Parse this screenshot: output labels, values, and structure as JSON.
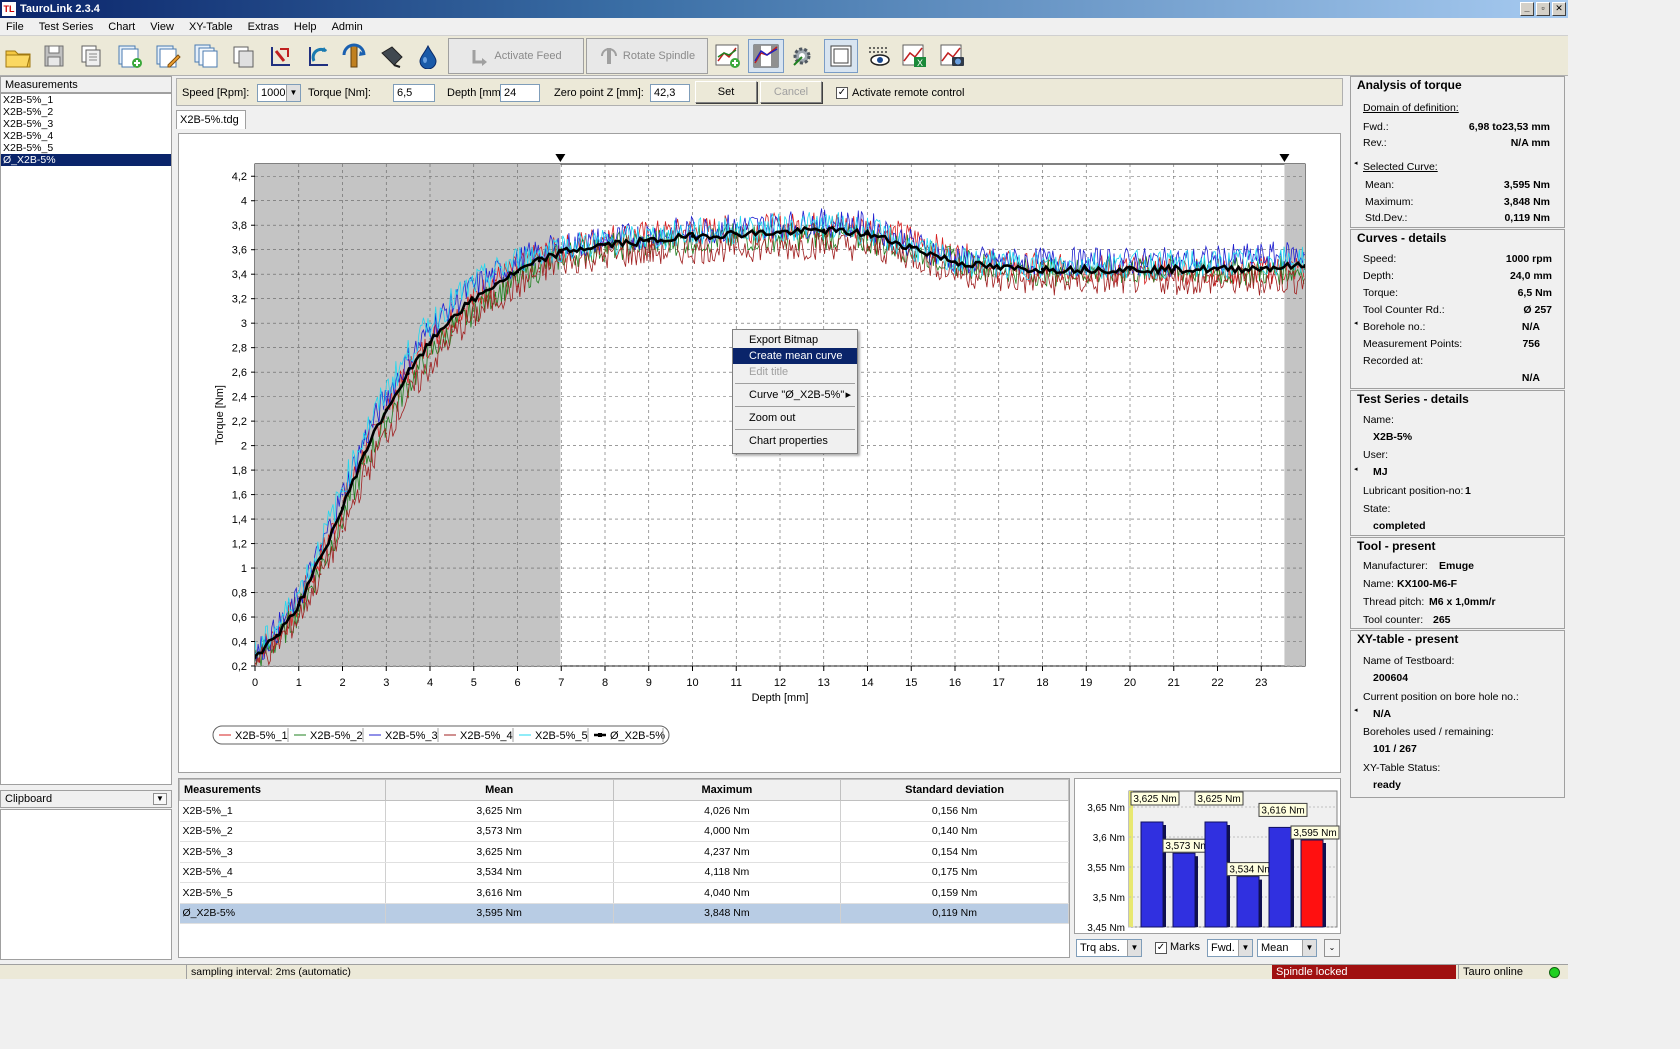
{
  "window": {
    "title": "TauroLink 2.3.4",
    "logo": "TL",
    "min": "_",
    "max": "▫",
    "close": "✕"
  },
  "menu": [
    "File",
    "Test Series",
    "Chart",
    "View",
    "XY-Table",
    "Extras",
    "Help",
    "Admin"
  ],
  "toolbar": {
    "activate_feed": "Activate Feed",
    "rotate_spindle": "Rotate Spindle"
  },
  "measurements_panel": {
    "title": "Measurements",
    "items": [
      "X2B-5%_1",
      "X2B-5%_2",
      "X2B-5%_3",
      "X2B-5%_4",
      "X2B-5%_5",
      "Ø_X2B-5%"
    ],
    "selected_index": 5
  },
  "clipboard_panel": {
    "title": "Clipboard"
  },
  "controls": {
    "speed_label": "Speed [Rpm]:",
    "speed_value": "1000",
    "torque_label": "Torque [Nm]:",
    "torque_value": "6,5",
    "depth_label": "Depth [mm]",
    "depth_value": "24",
    "zero_label": "Zero point Z [mm]:",
    "zero_value": "42,3",
    "set_label": "Set",
    "cancel_label": "Cancel",
    "remote_label": "Activate remote control",
    "remote_checked": true
  },
  "file_tab": "X2B-5%.tdg",
  "chart_data": {
    "type": "line",
    "xlabel": "Depth [mm]",
    "ylabel": "Torque [Nm]",
    "xlim": [
      0,
      24
    ],
    "ylim": [
      0.2,
      4.3
    ],
    "xticks": [
      "0",
      "1",
      "2",
      "3",
      "4",
      "5",
      "6",
      "7",
      "8",
      "9",
      "10",
      "11",
      "12",
      "13",
      "14",
      "15",
      "16",
      "17",
      "18",
      "19",
      "20",
      "21",
      "22",
      "23"
    ],
    "yticks": [
      "0,2",
      "0,4",
      "0,6",
      "0,8",
      "1",
      "1,2",
      "1,4",
      "1,6",
      "1,8",
      "2",
      "2,2",
      "2,4",
      "2,6",
      "2,8",
      "3",
      "3,2",
      "3,4",
      "3,6",
      "3,8",
      "4",
      "4,2"
    ],
    "grid": true,
    "shaded_regions": [
      [
        0,
        6.98
      ],
      [
        23.53,
        24
      ]
    ],
    "markers": [
      6.98,
      23.53
    ],
    "legend_position": "bottom-left",
    "series": [
      {
        "name": "X2B-5%_1",
        "color": "#d62020",
        "x": [
          0,
          0.5,
          1,
          1.5,
          2,
          2.5,
          3,
          3.5,
          4,
          4.5,
          5,
          5.5,
          6,
          6.5,
          7,
          8,
          9,
          10,
          11,
          12,
          13,
          14,
          15,
          16,
          17,
          18,
          19,
          20,
          21,
          22,
          23,
          24
        ],
        "y": [
          0.3,
          0.45,
          0.7,
          1.1,
          1.5,
          1.95,
          2.3,
          2.6,
          2.85,
          3.05,
          3.2,
          3.35,
          3.45,
          3.55,
          3.6,
          3.7,
          3.72,
          3.75,
          3.77,
          3.78,
          3.8,
          3.78,
          3.7,
          3.55,
          3.48,
          3.45,
          3.44,
          3.44,
          3.44,
          3.42,
          3.43,
          3.45
        ]
      },
      {
        "name": "X2B-5%_2",
        "color": "#208020",
        "x": [
          0,
          0.5,
          1,
          1.5,
          2,
          2.5,
          3,
          3.5,
          4,
          4.5,
          5,
          5.5,
          6,
          6.5,
          7,
          8,
          9,
          10,
          11,
          12,
          13,
          14,
          15,
          16,
          17,
          18,
          19,
          20,
          21,
          22,
          23,
          24
        ],
        "y": [
          0.25,
          0.4,
          0.65,
          1.0,
          1.4,
          1.85,
          2.2,
          2.5,
          2.75,
          2.95,
          3.1,
          3.25,
          3.35,
          3.45,
          3.55,
          3.62,
          3.65,
          3.68,
          3.7,
          3.7,
          3.72,
          3.68,
          3.6,
          3.5,
          3.45,
          3.42,
          3.42,
          3.43,
          3.43,
          3.42,
          3.42,
          3.44
        ]
      },
      {
        "name": "X2B-5%_3",
        "color": "#2020d0",
        "x": [
          0,
          0.5,
          1,
          1.5,
          2,
          2.5,
          3,
          3.5,
          4,
          4.5,
          5,
          5.5,
          6,
          6.5,
          7,
          8,
          9,
          10,
          11,
          12,
          13,
          14,
          15,
          16,
          17,
          18,
          19,
          20,
          21,
          22,
          23,
          24
        ],
        "y": [
          0.28,
          0.5,
          0.75,
          1.15,
          1.6,
          2.05,
          2.4,
          2.7,
          2.95,
          3.15,
          3.3,
          3.4,
          3.5,
          3.58,
          3.62,
          3.68,
          3.72,
          3.76,
          3.78,
          3.8,
          3.82,
          3.8,
          3.65,
          3.52,
          3.5,
          3.5,
          3.5,
          3.5,
          3.5,
          3.52,
          3.54,
          3.56
        ]
      },
      {
        "name": "X2B-5%_4",
        "color": "#a02020",
        "x": [
          0,
          0.5,
          1,
          1.5,
          2,
          2.5,
          3,
          3.5,
          4,
          4.5,
          5,
          5.5,
          6,
          6.5,
          7,
          8,
          9,
          10,
          11,
          12,
          13,
          14,
          15,
          16,
          17,
          18,
          19,
          20,
          21,
          22,
          23,
          24
        ],
        "y": [
          0.22,
          0.38,
          0.6,
          0.95,
          1.3,
          1.75,
          2.1,
          2.4,
          2.65,
          2.9,
          3.05,
          3.2,
          3.3,
          3.42,
          3.5,
          3.55,
          3.58,
          3.6,
          3.62,
          3.62,
          3.64,
          3.62,
          3.55,
          3.42,
          3.36,
          3.34,
          3.34,
          3.35,
          3.35,
          3.34,
          3.34,
          3.36
        ]
      },
      {
        "name": "X2B-5%_5",
        "color": "#20d8f0",
        "x": [
          0,
          0.5,
          1,
          1.5,
          2,
          2.5,
          3,
          3.5,
          4,
          4.5,
          5,
          5.5,
          6,
          6.5,
          7,
          8,
          9,
          10,
          11,
          12,
          13,
          14,
          15,
          16,
          17,
          18,
          19,
          20,
          21,
          22,
          23,
          24
        ],
        "y": [
          0.3,
          0.52,
          0.8,
          1.2,
          1.65,
          2.1,
          2.45,
          2.75,
          3.0,
          3.18,
          3.32,
          3.42,
          3.52,
          3.58,
          3.62,
          3.66,
          3.7,
          3.74,
          3.76,
          3.78,
          3.8,
          3.76,
          3.62,
          3.5,
          3.48,
          3.47,
          3.48,
          3.48,
          3.48,
          3.48,
          3.5,
          3.52
        ]
      },
      {
        "name": "Ø_X2B-5%",
        "color": "#000000",
        "x": [
          0,
          0.5,
          1,
          1.5,
          2,
          2.5,
          3,
          3.5,
          4,
          4.5,
          5,
          5.5,
          6,
          6.5,
          7,
          8,
          9,
          10,
          11,
          12,
          13,
          14,
          15,
          16,
          17,
          18,
          19,
          20,
          21,
          22,
          23,
          24
        ],
        "y": [
          0.27,
          0.45,
          0.7,
          1.08,
          1.49,
          1.94,
          2.29,
          2.59,
          2.84,
          3.05,
          3.19,
          3.32,
          3.42,
          3.51,
          3.58,
          3.64,
          3.67,
          3.71,
          3.73,
          3.74,
          3.76,
          3.73,
          3.62,
          3.5,
          3.45,
          3.44,
          3.44,
          3.44,
          3.44,
          3.44,
          3.45,
          3.47
        ]
      }
    ]
  },
  "context_menu": {
    "items": [
      "Export Bitmap",
      "Create mean curve",
      "Edit title",
      "Curve \"Ø_X2B-5%\"",
      "Zoom out",
      "Chart properties"
    ],
    "submenu_arrow": "▸"
  },
  "results_table": {
    "headers": [
      "Measurements",
      "Mean",
      "Maximum",
      "Standard deviation"
    ],
    "rows": [
      [
        "X2B-5%_1",
        "3,625 Nm",
        "4,026 Nm",
        "0,156 Nm"
      ],
      [
        "X2B-5%_2",
        "3,573 Nm",
        "4,000 Nm",
        "0,140 Nm"
      ],
      [
        "X2B-5%_3",
        "3,625 Nm",
        "4,237 Nm",
        "0,154 Nm"
      ],
      [
        "X2B-5%_4",
        "3,534 Nm",
        "4,118 Nm",
        "0,175 Nm"
      ],
      [
        "X2B-5%_5",
        "3,616 Nm",
        "4,040 Nm",
        "0,159 Nm"
      ],
      [
        "Ø_X2B-5%",
        "3,595 Nm",
        "3,848 Nm",
        "0,119 Nm"
      ]
    ],
    "selected_row": 5
  },
  "bar_chart": {
    "yticks": [
      "3,65 Nm",
      "3,6 Nm",
      "3,55 Nm",
      "3,5 Nm",
      "3,45 Nm"
    ],
    "ylim": [
      3.45,
      3.66
    ],
    "values": [
      3.625,
      3.573,
      3.625,
      3.534,
      3.616,
      3.595
    ],
    "labels": [
      "3,625 Nm",
      "3,573 Nm",
      "3,625 Nm",
      "3,534 Nm",
      "3,616 Nm",
      "3,595 Nm"
    ],
    "colors": [
      "#3030e0",
      "#3030e0",
      "#3030e0",
      "#3030e0",
      "#3030e0",
      "#ff1010"
    ]
  },
  "bar_controls": {
    "mode": "Trq abs.",
    "marks_label": "Marks",
    "marks_checked": true,
    "direction": "Fwd.",
    "stat": "Mean"
  },
  "right_panel": {
    "analysis": {
      "title": "Analysis of torque",
      "domain_label": "Domain of definition:",
      "fwd_label": "Fwd.:",
      "fwd_value": "6,98 to23,53  mm",
      "rev_label": "Rev.:",
      "rev_value": "N/A   mm",
      "selected_label": "Selected Curve:",
      "mean_label": "Mean:",
      "mean_value": "3,595  Nm",
      "max_label": "Maximum:",
      "max_value": "3,848  Nm",
      "std_label": "Std.Dev.:",
      "std_value": "0,119  Nm"
    },
    "curves": {
      "title": "Curves - details",
      "speed_label": "Speed:",
      "speed_value": "1000  rpm",
      "depth_label": "Depth:",
      "depth_value": "24,0  mm",
      "torque_label": "Torque:",
      "torque_value": "6,5  Nm",
      "counter_label": "Tool Counter Rd.:",
      "counter_value": "Ø 257",
      "bore_label": "Borehole no.:",
      "bore_value": "N/A",
      "points_label": "Measurement Points:",
      "points_value": "756",
      "recorded_label": "Recorded at:",
      "recorded_value": "N/A"
    },
    "series": {
      "title": "Test Series - details",
      "name_label": "Name:",
      "name_value": "X2B-5%",
      "user_label": "User:",
      "user_value": "MJ",
      "lub_label": "Lubricant position-no:",
      "lub_value": "1",
      "state_label": "State:",
      "state_value": "completed"
    },
    "tool": {
      "title": "Tool - present",
      "man_label": "Manufacturer:",
      "man_value": "Emuge",
      "name_label": "Name:",
      "name_value": "KX100-M6-F",
      "pitch_label": "Thread pitch:",
      "pitch_value": "M6 x  1,0mm/r",
      "counter_label": "Tool counter:",
      "counter_value": "265"
    },
    "xy": {
      "title": "XY-table - present",
      "board_label": "Name of Testboard:",
      "board_value": "200604",
      "pos_label": "Current position on bore hole no.:",
      "pos_value": "N/A",
      "used_label": "Boreholes used / remaining:",
      "used_value": "101 / 267",
      "status_label": "XY-Table Status:",
      "status_value": "ready"
    }
  },
  "status": {
    "sampling": "sampling interval: 2ms (automatic)",
    "spindle": "Spindle locked",
    "tauro": "Tauro online"
  }
}
